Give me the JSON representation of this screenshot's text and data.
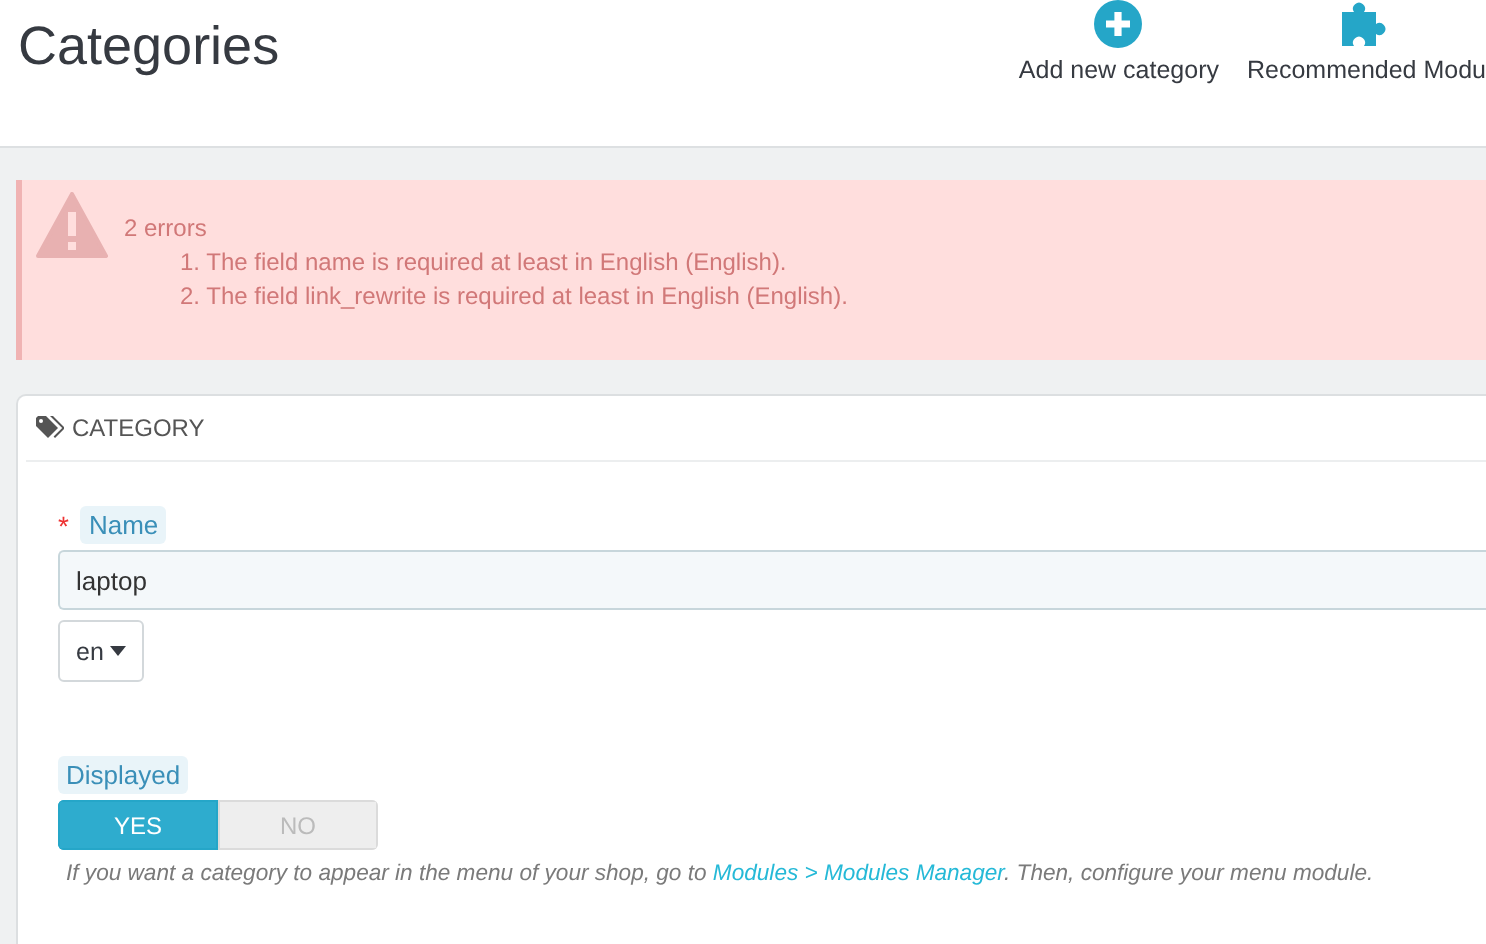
{
  "header": {
    "title": "Categories",
    "actions": [
      {
        "label": "Add new category",
        "kind": "plus"
      },
      {
        "label": "Recommended Modu",
        "kind": "puzzle"
      }
    ]
  },
  "alert": {
    "title": "2 errors",
    "errors": [
      "1. The field name is required at least in English (English).",
      "2. The field link_rewrite is required at least in English (English)."
    ]
  },
  "panel": {
    "title": "CATEGORY",
    "name_field": {
      "label": "Name",
      "required_mark": "*",
      "value": "laptop",
      "language": "en"
    },
    "displayed": {
      "label": "Displayed",
      "options": [
        {
          "label": "YES",
          "selected": true
        },
        {
          "label": "NO",
          "selected": false
        }
      ],
      "hint_before": "If you want a category to appear in the menu of your shop, go to ",
      "hint_link": "Modules > Modules Manager",
      "hint_after": ". Then, configure your menu module."
    }
  }
}
